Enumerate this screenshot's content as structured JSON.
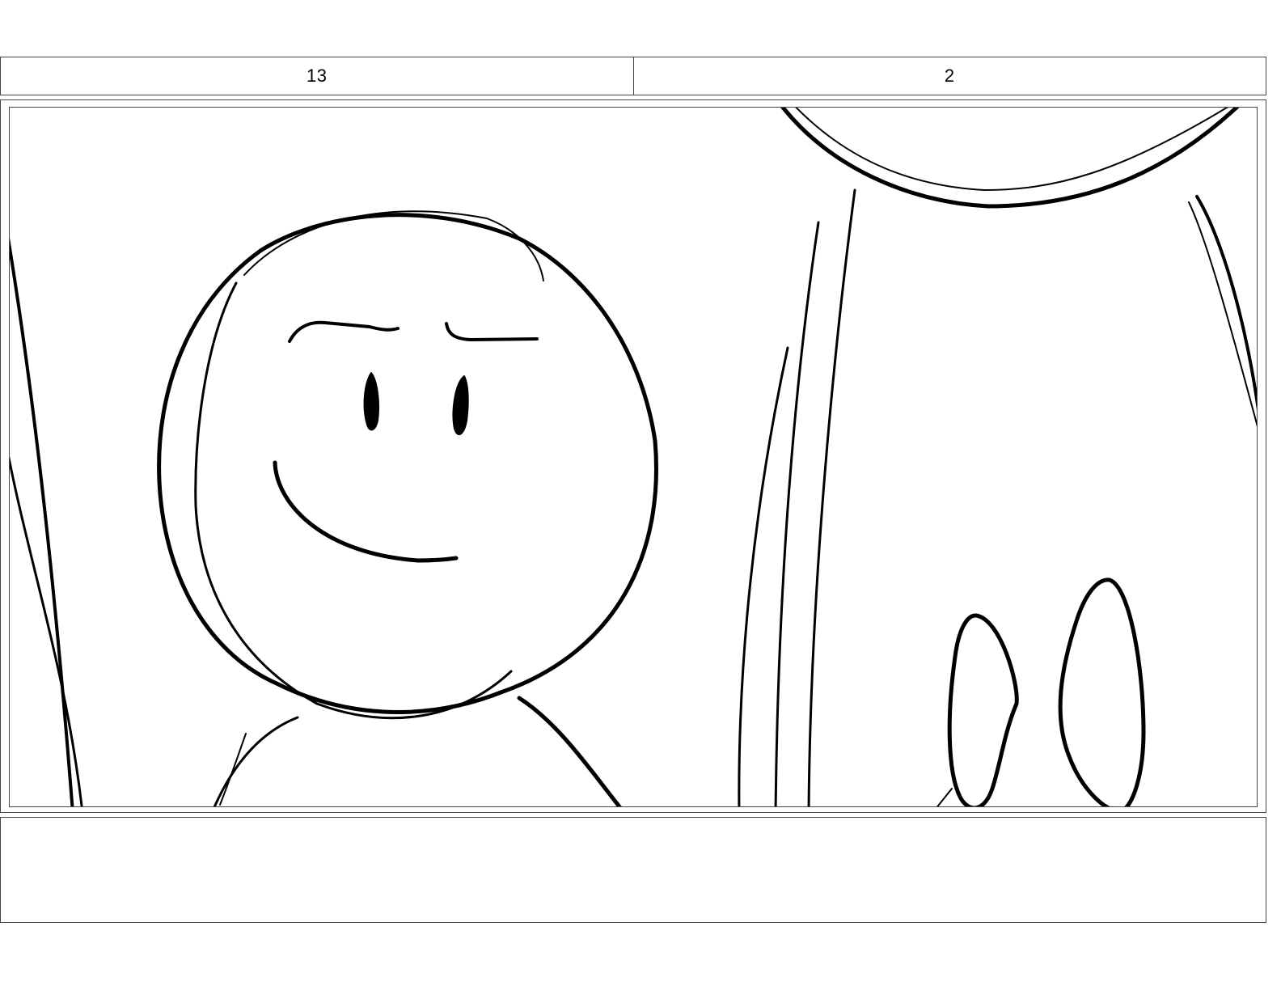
{
  "header": {
    "scene_number": "13",
    "shot_number": "2"
  },
  "panel": {
    "drawing": "storyboard-sketch"
  },
  "notes": {
    "text": ""
  }
}
